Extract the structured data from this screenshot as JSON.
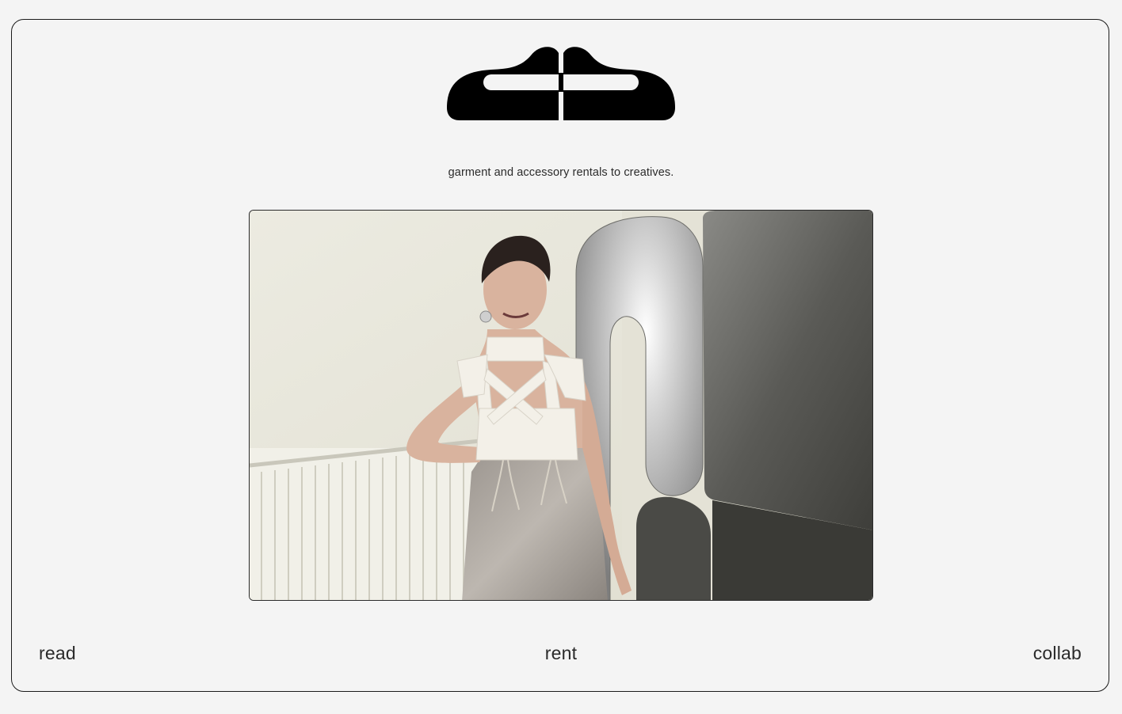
{
  "brand": {
    "logo_icon": "abstract-glyph-logo",
    "logo_color": "#000000"
  },
  "hero": {
    "tagline": "garment and accessory rentals to creatives.",
    "photo_subject": "editorial-fashion-photo"
  },
  "nav": {
    "read_label": "read",
    "rent_label": "rent",
    "collab_label": "collab"
  },
  "colors": {
    "background": "#f4f4f4",
    "border": "#1a1a1a",
    "text": "#2a2a2a"
  }
}
